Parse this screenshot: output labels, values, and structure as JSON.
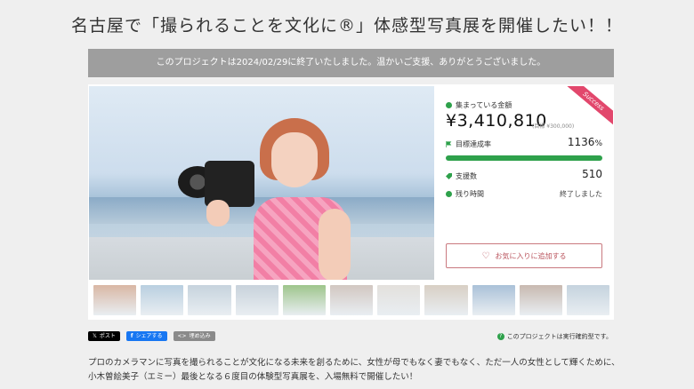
{
  "title": "名古屋で「撮られることを文化に®」体感型写真展を開催したい！！",
  "banner": "このプロジェクトは2024/02/29に終了いたしました。温かいご支援、ありがとうございました。",
  "ribbon": "Success",
  "stats": {
    "amount_label": "集まっている金額",
    "amount": "¥3,410,810",
    "goal": "(目標 ¥300,000)",
    "rate_label": "目標達成率",
    "rate_value": "1136",
    "rate_unit": "%",
    "rate_fraction": 1.0,
    "supporters_label": "支援数",
    "supporters": "510",
    "time_label": "残り時間",
    "time_value": "終了しました"
  },
  "favorite_button": "お気に入りに追加する",
  "thumbnails": [
    {
      "color": "#d9b7a4"
    },
    {
      "color": "#b9cfe0"
    },
    {
      "color": "#c6d3dd"
    },
    {
      "color": "#c8d2db"
    },
    {
      "color": "#9ec58c"
    },
    {
      "color": "#d2c7c1"
    },
    {
      "color": "#e3e0dc"
    },
    {
      "color": "#d8cfc4"
    },
    {
      "color": "#aac1d8"
    },
    {
      "color": "#c8b9b0"
    },
    {
      "color": "#c5d3de"
    }
  ],
  "share": {
    "post": "ポスト",
    "facebook": "シェアする",
    "embed": "埋め込み"
  },
  "all_or_nothing": "このプロジェクトは実行確約型です。",
  "description": "プロのカメラマンに写真を撮られることが文化になる未来を創るために、女性が母でもなく妻でもなく、ただ一人の女性として輝くために、小木曽絵美子（エミー）最後となる６度目の体験型写真展を、入場無料で開催したい！",
  "colors": {
    "accent_green": "#2ea14b",
    "ribbon_pink": "#e2476c",
    "fav_red": "#b9535c"
  }
}
